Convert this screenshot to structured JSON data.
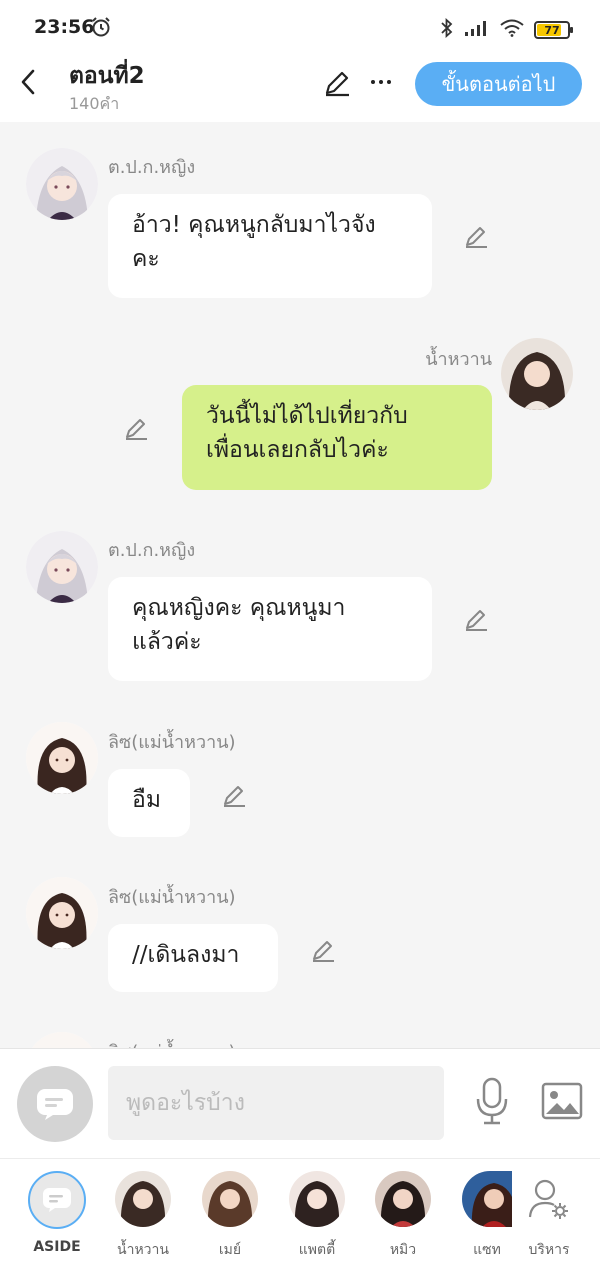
{
  "status_bar": {
    "time": "23:56",
    "battery": "77"
  },
  "header": {
    "title": "ตอนที่2",
    "subtitle": "140คำ",
    "next_label": "ขั้นตอนต่อไป"
  },
  "messages": [
    {
      "sender": "ต.ป.ก.หญิง",
      "lines": [
        "อ้าว! คุณหนูกลับมาไวจัง",
        "คะ"
      ],
      "side": "left"
    },
    {
      "sender": "น้ำหวาน",
      "lines": [
        "วันนี้ไม่ได้ไปเที่ยวกับ",
        "เพื่อนเลยกลับไวค่ะ"
      ],
      "side": "right"
    },
    {
      "sender": "ต.ป.ก.หญิง",
      "lines": [
        "คุณหญิงคะ คุณหนูมา",
        "แล้วค่ะ"
      ],
      "side": "left"
    },
    {
      "sender": "ลิซ(แม่น้ำหวาน)",
      "lines": [
        "อืม"
      ],
      "side": "left"
    },
    {
      "sender": "ลิซ(แม่น้ำหวาน)",
      "lines": [
        "//เดินลงมา"
      ],
      "side": "left"
    },
    {
      "sender": "ลิซ(แม่น้ำหวาน)",
      "lines": [],
      "side": "left"
    }
  ],
  "composer": {
    "placeholder": "พูดอะไรบ้าง"
  },
  "tabs": [
    {
      "label": "ASIDE"
    },
    {
      "label": "น้ำหวาน"
    },
    {
      "label": "เมย์"
    },
    {
      "label": "แพตตี้"
    },
    {
      "label": "หมิว"
    },
    {
      "label": "แซท"
    },
    {
      "label": "บริหาร"
    }
  ],
  "colors": {
    "accent": "#5aaef4",
    "my_bubble": "#d6f08b",
    "background": "#f5f5f5"
  }
}
